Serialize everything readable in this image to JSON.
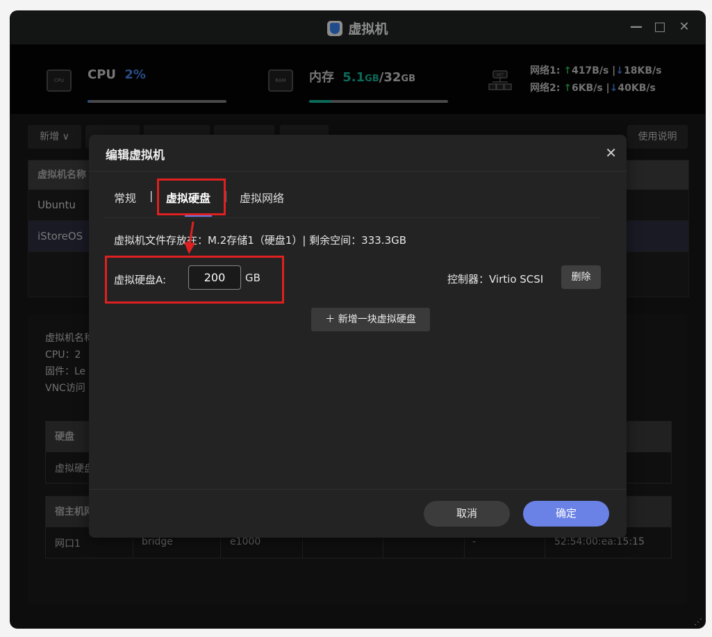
{
  "window": {
    "title": "虚拟机",
    "minimize": "—",
    "maximize": "□",
    "close": "✕"
  },
  "stats": {
    "cpu_label": "CPU",
    "cpu_value": "2%",
    "cpu_progress": 0.02,
    "mem_label": "内存",
    "mem_used": "5.1",
    "mem_used_unit": "GB",
    "mem_sep": "/",
    "mem_total": "32",
    "mem_total_unit": "GB",
    "mem_progress": 0.16,
    "cpu_chip_text": "CPU",
    "ram_chip_text": "RAM",
    "net_chip_text": "NET",
    "net1_label": "网络1:",
    "net1_up": "417B/s",
    "net1_sep": "|",
    "net1_down": "18KB/s",
    "net2_label": "网络2:",
    "net2_up": "6KB/s",
    "net2_sep": "|",
    "net2_down": "40KB/s",
    "up_arrow": "↑",
    "down_arrow": "↓"
  },
  "toolbar": {
    "new_label": "新增 ∨",
    "help_label": "使用说明"
  },
  "vm_list": {
    "header": "虚拟机名称",
    "rows": [
      "Ubuntu",
      "iStoreOS"
    ]
  },
  "detail": {
    "lines": [
      "虚拟机名称",
      "CPU：2",
      "固件：Le",
      "VNC访问"
    ],
    "disk_table_header": "硬盘",
    "disk_table_row": "虚拟硬盘",
    "net_table_header": "宿主机网",
    "net_row": {
      "c1": "网口1",
      "c2": "bridge",
      "c3": "e1000",
      "c4": "-",
      "c5": "52:54:00:ea:15:15"
    }
  },
  "modal": {
    "title": "编辑虚拟机",
    "close": "✕",
    "tabs": [
      "常规",
      "虚拟硬盘",
      "虚拟网络"
    ],
    "tab_sep": "|",
    "info_line": "虚拟机文件存放在：M.2存储1（硬盘1）| 剩余空间：333.3GB",
    "disk_label": "虚拟硬盘A:",
    "disk_size": "200",
    "disk_unit": "GB",
    "controller_label": "控制器：Virtio SCSI",
    "delete_label": "删除",
    "add_disk_label": "＋ 新增一块虚拟硬盘",
    "cancel_label": "取消",
    "ok_label": "确定"
  },
  "colors": {
    "accent": "#6a81e6",
    "cpu": "#4a8cf2",
    "ram": "#16c1a3",
    "annotation": "#e02020"
  }
}
